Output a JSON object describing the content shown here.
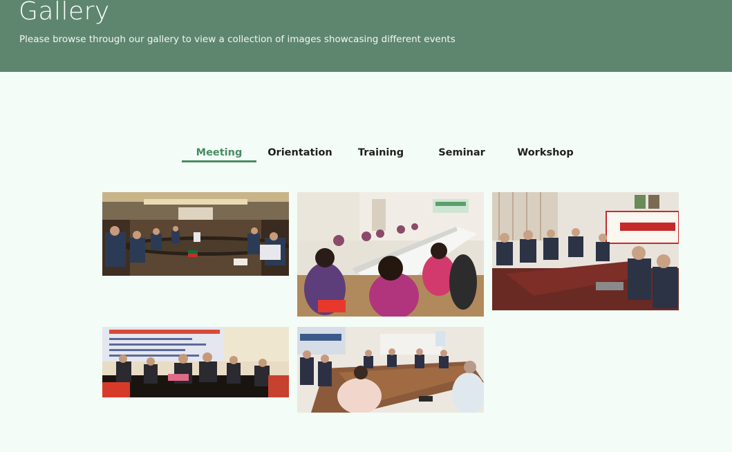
{
  "hero": {
    "title": "Gallery",
    "subtitle": "Please browse through our gallery to view a collection of images showcasing different events"
  },
  "tabs": [
    {
      "label": "Meeting",
      "active": true
    },
    {
      "label": "Orientation",
      "active": false
    },
    {
      "label": "Training",
      "active": false
    },
    {
      "label": "Seminar",
      "active": false
    },
    {
      "label": "Workshop",
      "active": false
    }
  ],
  "colors": {
    "header_bg": "#5e866e",
    "page_bg": "#f3fcf6",
    "accent": "#4a8a63"
  },
  "gallery": {
    "images": [
      {
        "name": "meeting-photo-1"
      },
      {
        "name": "meeting-photo-2"
      },
      {
        "name": "meeting-photo-3"
      },
      {
        "name": "meeting-photo-4"
      },
      {
        "name": "meeting-photo-5"
      }
    ]
  }
}
